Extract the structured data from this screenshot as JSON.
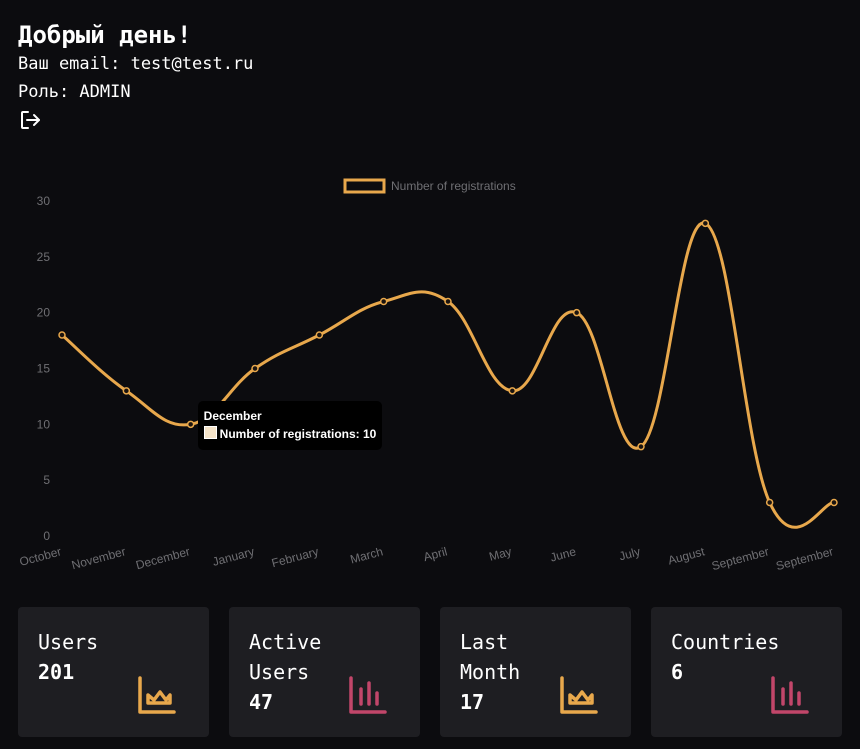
{
  "header": {
    "greeting": "Добрый день!",
    "email_line": "Ваш email: test@test.ru",
    "role_line": "Роль: ADMIN",
    "logout_icon": "logout-icon"
  },
  "chart_data": {
    "type": "line",
    "categories": [
      "October",
      "November",
      "December",
      "January",
      "February",
      "March",
      "April",
      "May",
      "June",
      "July",
      "August",
      "September",
      "September"
    ],
    "series": [
      {
        "name": "Number of registrations",
        "values": [
          18,
          13,
          10,
          15,
          18,
          21,
          21,
          13,
          20,
          8,
          28,
          3,
          3
        ],
        "color": "#e8a84c"
      }
    ],
    "ylim": [
      0,
      30
    ],
    "yticks": [
      0,
      5,
      10,
      15,
      20,
      25,
      30
    ],
    "legend_position": "top-center",
    "grid": false,
    "tooltip": {
      "title": "December",
      "label": "Number of registrations: 10"
    }
  },
  "cards": [
    {
      "label": "Users",
      "value": "201",
      "icon": "crown-chart-icon",
      "icon_color": "#e8a84c"
    },
    {
      "label": "Active\nUsers",
      "value": "47",
      "icon": "bar-chart-icon",
      "icon_color": "#c2466a"
    },
    {
      "label": "Last\nMonth",
      "value": "17",
      "icon": "crown-chart-icon",
      "icon_color": "#e8a84c"
    },
    {
      "label": "Countries",
      "value": "6",
      "icon": "bar-chart-icon",
      "icon_color": "#c2466a"
    }
  ]
}
